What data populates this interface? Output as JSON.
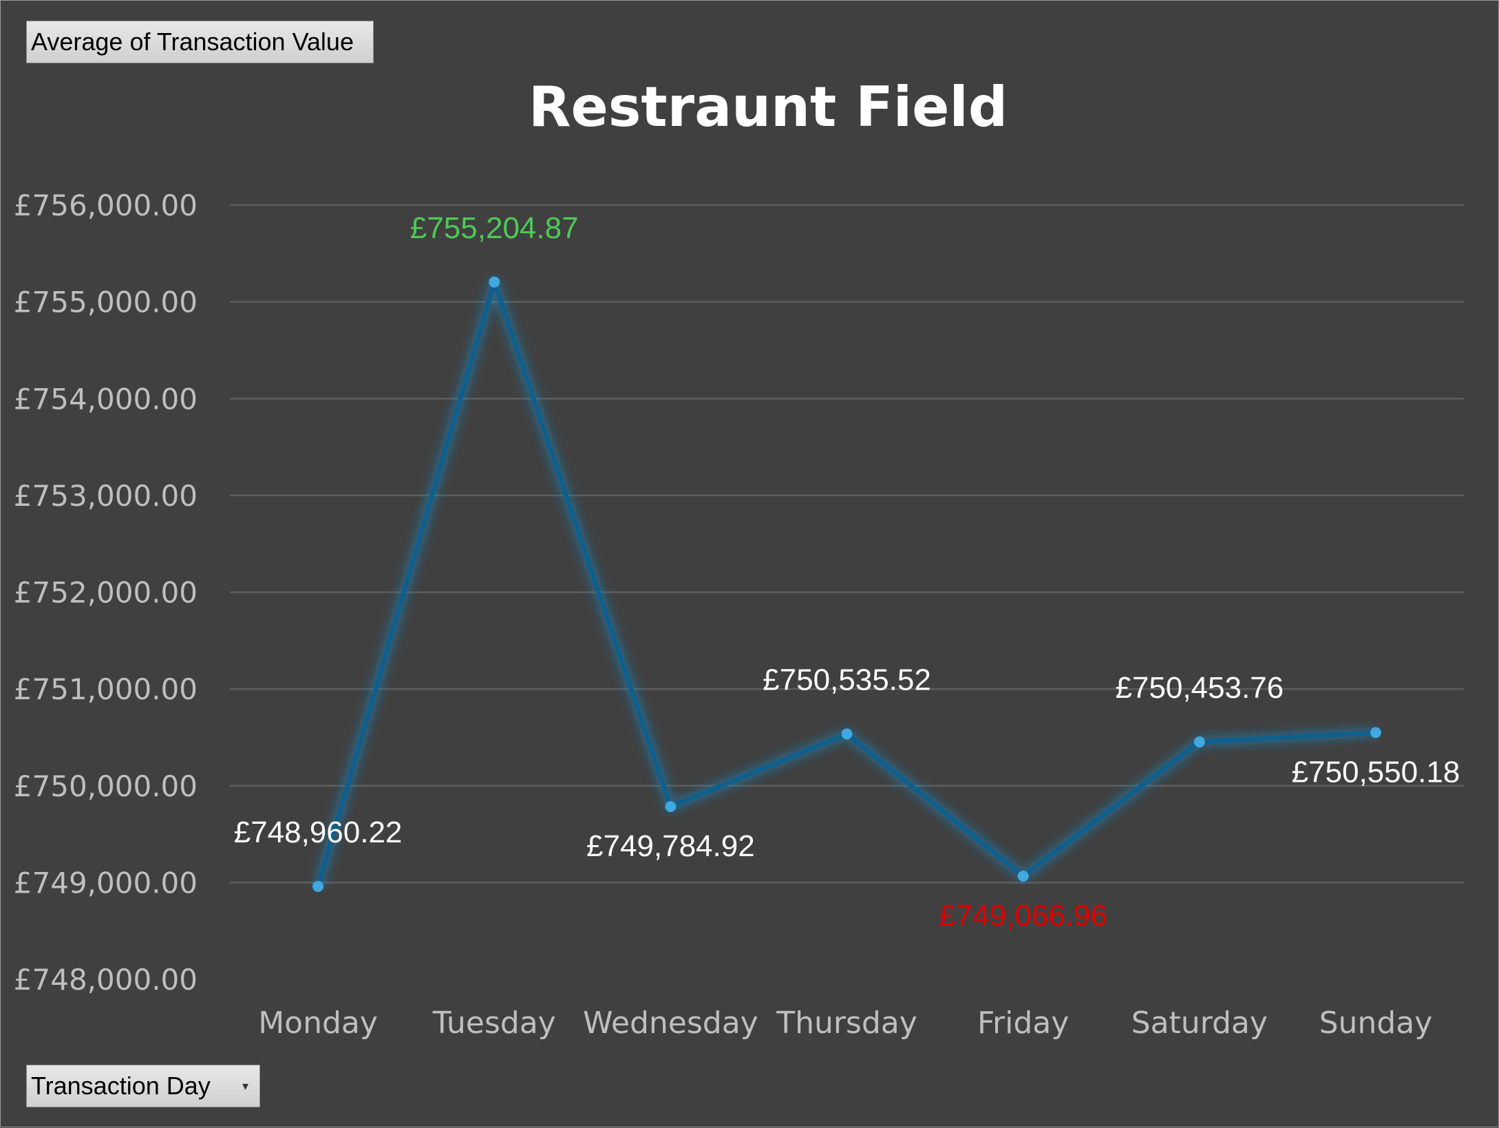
{
  "controls": {
    "values_field": "Average  of Transaction Value",
    "axis_field": "Transaction Day",
    "axis_field_icon": "dropdown-arrow-icon"
  },
  "chart_data": {
    "type": "line",
    "title": "Restraunt Field",
    "categories": [
      "Monday",
      "Tuesday",
      "Wednesday",
      "Thursday",
      "Friday",
      "Saturday",
      "Sunday"
    ],
    "series": [
      {
        "values": [
          748960.22,
          755204.87,
          749784.92,
          750535.52,
          749066.96,
          750453.76,
          750550.18
        ],
        "data_labels": [
          "£748,960.22",
          "£755,204.87",
          "£749,784.92",
          "£750,535.52",
          "£749,066.96",
          "£750,453.76",
          "£750,550.18"
        ],
        "label_colors": [
          "#ffffff",
          "#4ec957",
          "#ffffff",
          "#ffffff",
          "#e00000",
          "#ffffff",
          "#ffffff"
        ],
        "label_position": [
          "above",
          "above",
          "below",
          "above",
          "below",
          "above",
          "below"
        ],
        "line_color": "#0f5f8c",
        "marker_color": "#3fa9e0"
      }
    ],
    "yticks": [
      748000,
      749000,
      750000,
      751000,
      752000,
      753000,
      754000,
      755000,
      756000
    ],
    "ytick_labels": [
      "£748,000.00",
      "£749,000.00",
      "£750,000.00",
      "£751,000.00",
      "£752,000.00",
      "£753,000.00",
      "£754,000.00",
      "£755,000.00",
      "£756,000.00"
    ],
    "ylim": [
      748000,
      756000
    ],
    "grid": true,
    "legend": "none",
    "xlabel": "",
    "ylabel": ""
  }
}
